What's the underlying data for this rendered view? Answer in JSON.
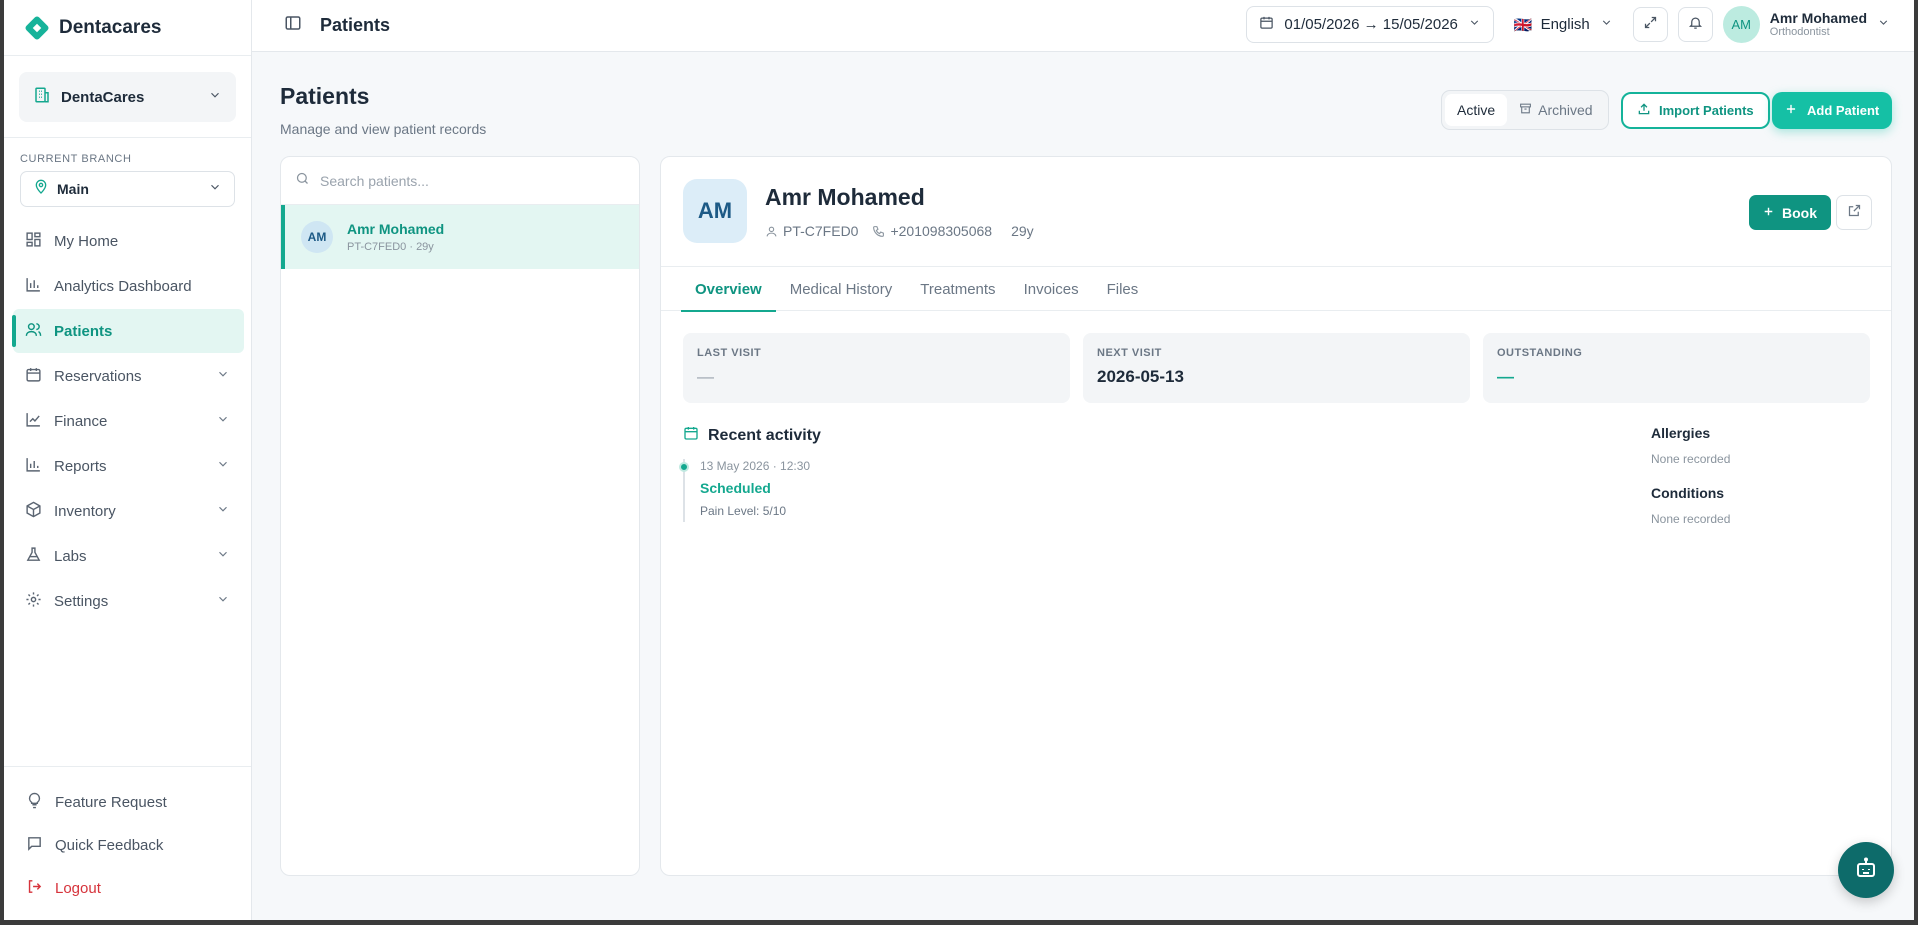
{
  "brand": {
    "name": "Dentacares"
  },
  "sidebar": {
    "org_name": "DentaCares",
    "branch_label": "CURRENT BRANCH",
    "branch_value": "Main",
    "items": [
      {
        "label": "My Home",
        "icon": "grid-icon"
      },
      {
        "label": "Analytics Dashboard",
        "icon": "bar-chart-icon"
      },
      {
        "label": "Patients",
        "icon": "users-icon",
        "active": true
      },
      {
        "label": "Reservations",
        "icon": "calendar-icon"
      },
      {
        "label": "Finance",
        "icon": "line-chart-icon"
      },
      {
        "label": "Reports",
        "icon": "bar-chart-icon"
      },
      {
        "label": "Inventory",
        "icon": "box-icon"
      },
      {
        "label": "Labs",
        "icon": "flask-icon"
      },
      {
        "label": "Settings",
        "icon": "gear-icon"
      }
    ],
    "footer": [
      {
        "label": "Feature Request",
        "icon": "lightbulb-icon"
      },
      {
        "label": "Quick Feedback",
        "icon": "message-icon"
      },
      {
        "label": "Logout",
        "icon": "logout-icon"
      }
    ]
  },
  "topbar": {
    "title": "Patients",
    "date_range": "01/05/2026 → 15/05/2026",
    "language": "English",
    "flag": "🇬🇧",
    "user": {
      "initials": "AM",
      "name": "Amr Mohamed",
      "role": "Orthodontist"
    }
  },
  "page": {
    "title": "Patients",
    "subtitle": "Manage and view patient records",
    "filter": {
      "active": "Active",
      "archived": "Archived"
    },
    "import_label": "Import Patients",
    "add_label": "Add Patient"
  },
  "patient_list": {
    "search_placeholder": "Search patients...",
    "rows": [
      {
        "initials": "AM",
        "name": "Amr Mohamed",
        "sub": "PT-C7FED0 · 29y"
      }
    ]
  },
  "patient": {
    "initials": "AM",
    "name": "Amr Mohamed",
    "id": "PT-C7FED0",
    "phone": "+201098305068",
    "age": "29y",
    "book_label": "Book",
    "tabs": [
      "Overview",
      "Medical History",
      "Treatments",
      "Invoices",
      "Files"
    ],
    "stats": [
      {
        "label": "LAST VISIT",
        "value": "—"
      },
      {
        "label": "NEXT VISIT",
        "value": "2026-05-13"
      },
      {
        "label": "OUTSTANDING",
        "value": "—"
      }
    ],
    "activity_title": "Recent activity",
    "activity": [
      {
        "time": "13 May 2026 · 12:30",
        "status": "Scheduled",
        "note": "Pain Level: 5/10"
      }
    ],
    "allergies_title": "Allergies",
    "allergies_value": "None recorded",
    "conditions_title": "Conditions",
    "conditions_value": "None recorded"
  },
  "colors": {
    "accent": "#14a88f",
    "accent_light": "#e3f6f2",
    "danger": "#d6333b"
  }
}
